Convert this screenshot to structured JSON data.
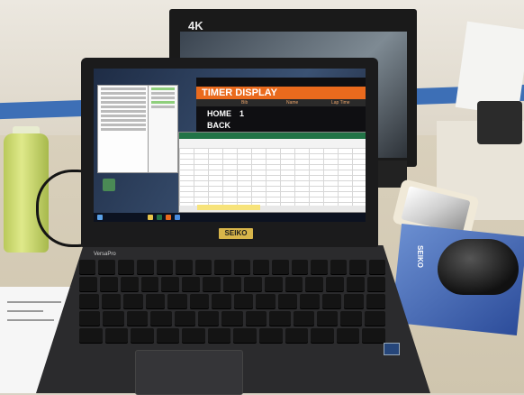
{
  "background": {
    "monitor_label": "4K"
  },
  "laptop": {
    "brand": "SEIKO",
    "model_label": "VersaPro"
  },
  "timer_display": {
    "title": "TIMER DISPLAY",
    "columns": [
      "Bib",
      "Name",
      "Lap Time"
    ],
    "rows": [
      {
        "label": "HOME",
        "bib": "1"
      },
      {
        "label": "BACK",
        "bib": ""
      }
    ],
    "title_color": "#ea6a1d"
  },
  "mousepad": {
    "logo": "SEIKO"
  },
  "colors": {
    "excel_green": "#227447",
    "stripe_blue": "#3d6fb6"
  }
}
